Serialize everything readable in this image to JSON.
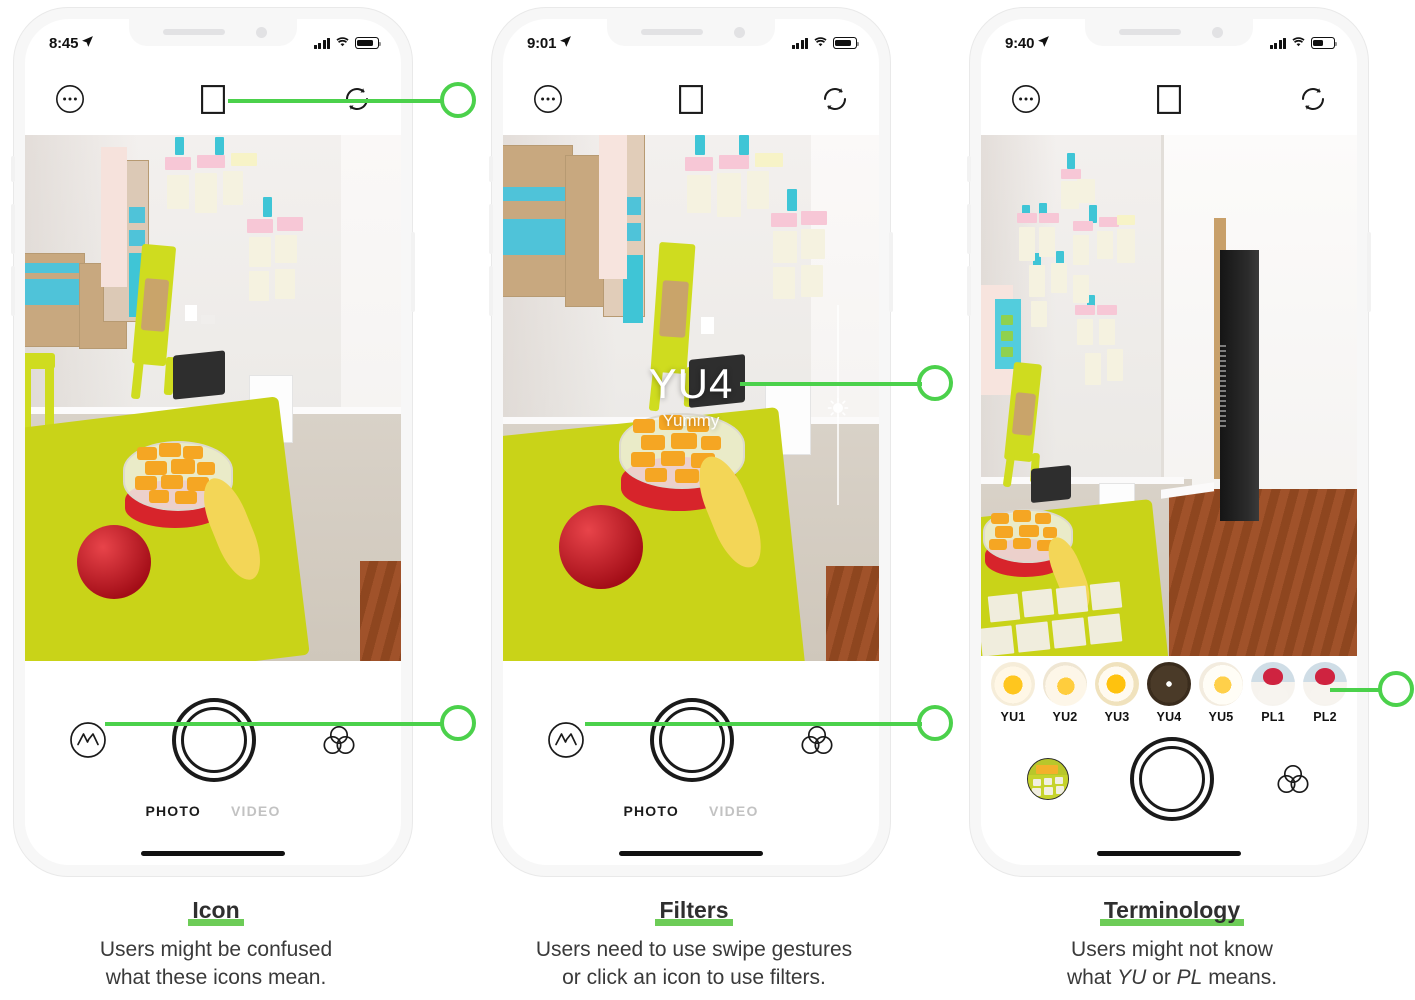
{
  "phones": [
    {
      "id": "phone-icon",
      "status": {
        "time": "8:45",
        "location_icon": "location-arrow-icon",
        "signal": "signal-bars-icon",
        "wifi": "wifi-icon",
        "battery": "battery-icon",
        "battery_level": 72
      },
      "topbar": {
        "more_icon": "ellipsis-circle-icon",
        "aspect_icon": "aspect-ratio-square-icon",
        "rotate_icon": "camera-rotate-icon"
      },
      "controls": {
        "effects_icon": "mountain-circle-icon",
        "shutter_icon": "shutter-button-icon",
        "filters_icon": "three-circles-filter-icon"
      },
      "modes": [
        {
          "label": "PHOTO",
          "active": true
        },
        {
          "label": "VIDEO",
          "active": false
        }
      ],
      "overlay": null,
      "filter_strip": null
    },
    {
      "id": "phone-filters",
      "status": {
        "time": "9:01",
        "location_icon": "location-arrow-icon",
        "signal": "signal-bars-icon",
        "wifi": "wifi-icon",
        "battery": "battery-icon",
        "battery_level": 72
      },
      "topbar": {
        "more_icon": "ellipsis-circle-icon",
        "aspect_icon": "aspect-ratio-square-icon",
        "rotate_icon": "camera-rotate-icon"
      },
      "controls": {
        "effects_icon": "mountain-circle-icon",
        "shutter_icon": "shutter-button-icon",
        "filters_icon": "three-circles-filter-icon"
      },
      "modes": [
        {
          "label": "PHOTO",
          "active": true
        },
        {
          "label": "VIDEO",
          "active": false
        }
      ],
      "overlay": {
        "filter_code": "YU4",
        "filter_name": "Yummy",
        "brightness_icon": "brightness-sun-slider-icon"
      },
      "filter_strip": null
    },
    {
      "id": "phone-terminology",
      "status": {
        "time": "9:40",
        "location_icon": "location-arrow-icon",
        "signal": "signal-bars-icon",
        "wifi": "wifi-icon",
        "battery": "battery-icon",
        "battery_level": 45
      },
      "topbar": {
        "more_icon": "ellipsis-circle-icon",
        "aspect_icon": "aspect-ratio-square-icon",
        "rotate_icon": "camera-rotate-icon"
      },
      "controls": {
        "gallery_icon": "gallery-thumbnail-icon",
        "shutter_icon": "shutter-button-icon",
        "filters_icon": "three-circles-filter-icon"
      },
      "modes": [],
      "overlay": null,
      "filter_strip": {
        "selected": "YU4",
        "items": [
          {
            "label": "YU1",
            "thumb": "th-yolk"
          },
          {
            "label": "YU2",
            "thumb": "th-yolk2"
          },
          {
            "label": "YU3",
            "thumb": "th-yolk3"
          },
          {
            "label": "YU4",
            "thumb": "th-dark"
          },
          {
            "label": "YU5",
            "thumb": "th-yolk5"
          },
          {
            "label": "PL1",
            "thumb": "th-berry"
          },
          {
            "label": "PL2",
            "thumb": "th-berry"
          }
        ]
      }
    }
  ],
  "annotations": {
    "accent_color": "#4bd14b",
    "callouts": [
      {
        "target": "camera-rotate-icon",
        "phone": "phone-icon"
      },
      {
        "target": "three-circles-filter-icon",
        "phone": "phone-icon"
      },
      {
        "target": "brightness-sun-slider-icon",
        "phone": "phone-filters"
      },
      {
        "target": "three-circles-filter-icon",
        "phone": "phone-filters"
      },
      {
        "target": "filter-strip",
        "phone": "phone-terminology"
      }
    ]
  },
  "captions": [
    {
      "title": "Icon",
      "body_line1": "Users might be confused",
      "body_line2": "what these icons mean."
    },
    {
      "title": "Filters",
      "body_line1": "Users need to use swipe gestures",
      "body_line2": "or click an icon to use filters."
    },
    {
      "title": "Terminology",
      "body_line1": "Users might not know",
      "body_line2_pre": "what ",
      "body_line2_em1": "YU",
      "body_line2_mid": " or ",
      "body_line2_em2": "PL",
      "body_line2_post": " means."
    }
  ]
}
